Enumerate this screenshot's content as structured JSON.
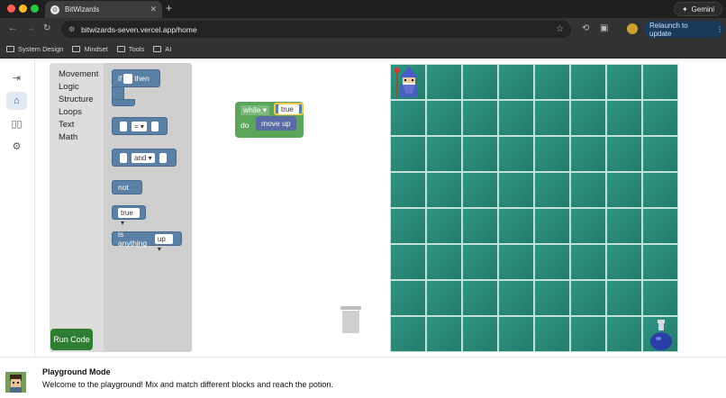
{
  "browser": {
    "tab_title": "BitWizards",
    "new_tab": "+",
    "gemini_label": "Gemini",
    "url": "bitwizards-seven.vercel.app/home",
    "relaunch_label": "Relaunch to update",
    "bookmarks": [
      "System Design",
      "Mindset",
      "Tools",
      "AI"
    ]
  },
  "sidebar": {
    "items": [
      {
        "name": "collapse",
        "icon": "collapse-icon"
      },
      {
        "name": "home",
        "icon": "home-icon",
        "active": true
      },
      {
        "name": "book",
        "icon": "book-icon"
      },
      {
        "name": "settings",
        "icon": "gear-icon"
      }
    ]
  },
  "toolbox": {
    "categories": [
      "Movement",
      "Logic",
      "Structure",
      "Loops",
      "Text",
      "Math"
    ],
    "blocks": {
      "if_label": "if",
      "then_label": "then",
      "compare_op": "=",
      "and_label": "and",
      "not_label": "not",
      "true_label": "true",
      "is_anything_label": "is anything",
      "up_label": "up"
    },
    "run_button": "Run Code"
  },
  "canvas": {
    "while_label": "while",
    "true_value": "true",
    "do_label": "do",
    "move_label": "move up"
  },
  "game": {
    "grid_size": 8,
    "wizard_cell": [
      0,
      0
    ],
    "potion_cell": [
      7,
      7
    ]
  },
  "footer": {
    "title": "Playground Mode",
    "message": "Welcome to the playground! Mix and match different blocks and reach the potion."
  },
  "colors": {
    "logic_block": "#5b80a5",
    "loop_block": "#5ba55b",
    "run_button": "#2e7d32",
    "grid": "#2a8a7a"
  }
}
